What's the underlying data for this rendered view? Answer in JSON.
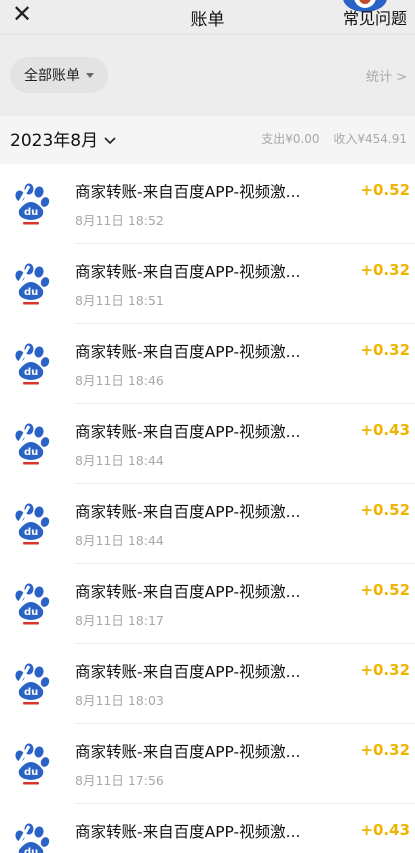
{
  "header": {
    "close_icon": "close-icon",
    "title": "账单",
    "faq_label": "常见问题"
  },
  "filter": {
    "chip_label": "全部账单",
    "stats_label": "统计 >"
  },
  "month": {
    "label": "2023年8月",
    "expense": "支出¥0.00",
    "income": "收入¥454.91"
  },
  "transactions": [
    {
      "name": "商家转账-来自百度APP-视频激...",
      "time": "8月11日 18:52",
      "amount": "+0.52"
    },
    {
      "name": "商家转账-来自百度APP-视频激...",
      "time": "8月11日 18:51",
      "amount": "+0.32"
    },
    {
      "name": "商家转账-来自百度APP-视频激...",
      "time": "8月11日 18:46",
      "amount": "+0.32"
    },
    {
      "name": "商家转账-来自百度APP-视频激...",
      "time": "8月11日 18:44",
      "amount": "+0.43"
    },
    {
      "name": "商家转账-来自百度APP-视频激...",
      "time": "8月11日 18:44",
      "amount": "+0.52"
    },
    {
      "name": "商家转账-来自百度APP-视频激...",
      "time": "8月11日 18:17",
      "amount": "+0.52"
    },
    {
      "name": "商家转账-来自百度APP-视频激...",
      "time": "8月11日 18:03",
      "amount": "+0.32"
    },
    {
      "name": "商家转账-来自百度APP-视频激...",
      "time": "8月11日 17:56",
      "amount": "+0.32"
    },
    {
      "name": "商家转账-来自百度APP-视频激...",
      "time": "",
      "amount": "+0.43"
    }
  ],
  "colors": {
    "amount": "#f0b400",
    "brand_blue": "#2b62c6",
    "brand_red": "#d9342b"
  }
}
